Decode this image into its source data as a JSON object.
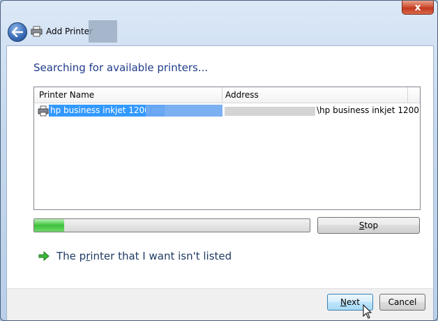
{
  "window": {
    "title": "Add Printer",
    "close_symbol": "x"
  },
  "page": {
    "heading": "Searching for available printers..."
  },
  "printer_list": {
    "columns": [
      "Printer Name",
      "Address"
    ],
    "rows": [
      {
        "name": "hp business inkjet 1200 on",
        "address": "\\hp business inkjet 1200"
      }
    ]
  },
  "progress": {
    "value": 0.11,
    "color": "#3ec13a"
  },
  "buttons": {
    "stop_prefix": "",
    "stop_underline": "S",
    "stop_rest": "top",
    "next_underline": "N",
    "next_rest": "ext",
    "cancel": "Cancel"
  },
  "link": {
    "part1": "The p",
    "underline": "r",
    "part2": "inter that I want isn't listed"
  },
  "icons": [
    "close-icon",
    "back-arrow-icon",
    "printer-icon",
    "green-arrow-icon",
    "mouse-cursor-icon"
  ],
  "colors": {
    "heading": "#1e3b8a",
    "selection": "#3399ff",
    "link": "#1e3a64"
  }
}
